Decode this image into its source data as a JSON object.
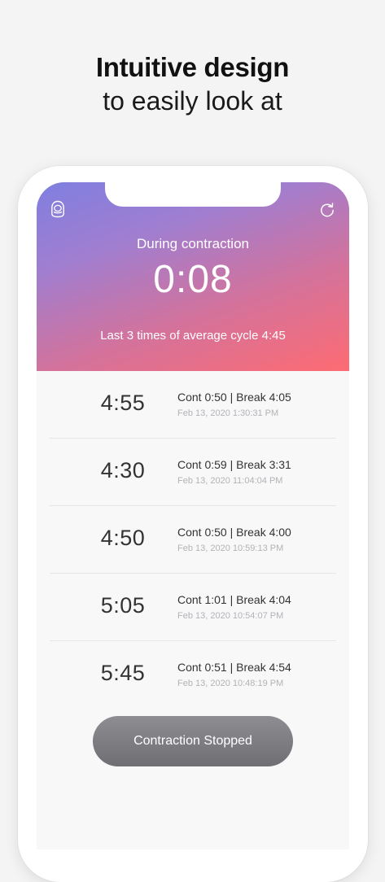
{
  "headline": {
    "line1": "Intuitive design",
    "line2": "to easily look at"
  },
  "header": {
    "status_label": "During contraction",
    "timer": "0:08",
    "average_text": "Last 3 times of average cycle 4:45",
    "left_icon": "baby-icon",
    "right_icon": "refresh-icon",
    "gradient": [
      "#7f7fe0",
      "#fd6b72"
    ]
  },
  "records": [
    {
      "cycle": "4:55",
      "detail": "Cont 0:50 | Break 4:05",
      "timestamp": "Feb 13, 2020 1:30:31 PM"
    },
    {
      "cycle": "4:30",
      "detail": "Cont 0:59 | Break 3:31",
      "timestamp": "Feb 13, 2020 11:04:04 PM"
    },
    {
      "cycle": "4:50",
      "detail": "Cont 0:50 | Break 4:00",
      "timestamp": "Feb 13, 2020 10:59:13 PM"
    },
    {
      "cycle": "5:05",
      "detail": "Cont 1:01 | Break 4:04",
      "timestamp": "Feb 13, 2020 10:54:07 PM"
    },
    {
      "cycle": "5:45",
      "detail": "Cont 0:51 | Break 4:54",
      "timestamp": "Feb 13, 2020 10:48:19 PM"
    }
  ],
  "action": {
    "label": "Contraction Stopped"
  }
}
